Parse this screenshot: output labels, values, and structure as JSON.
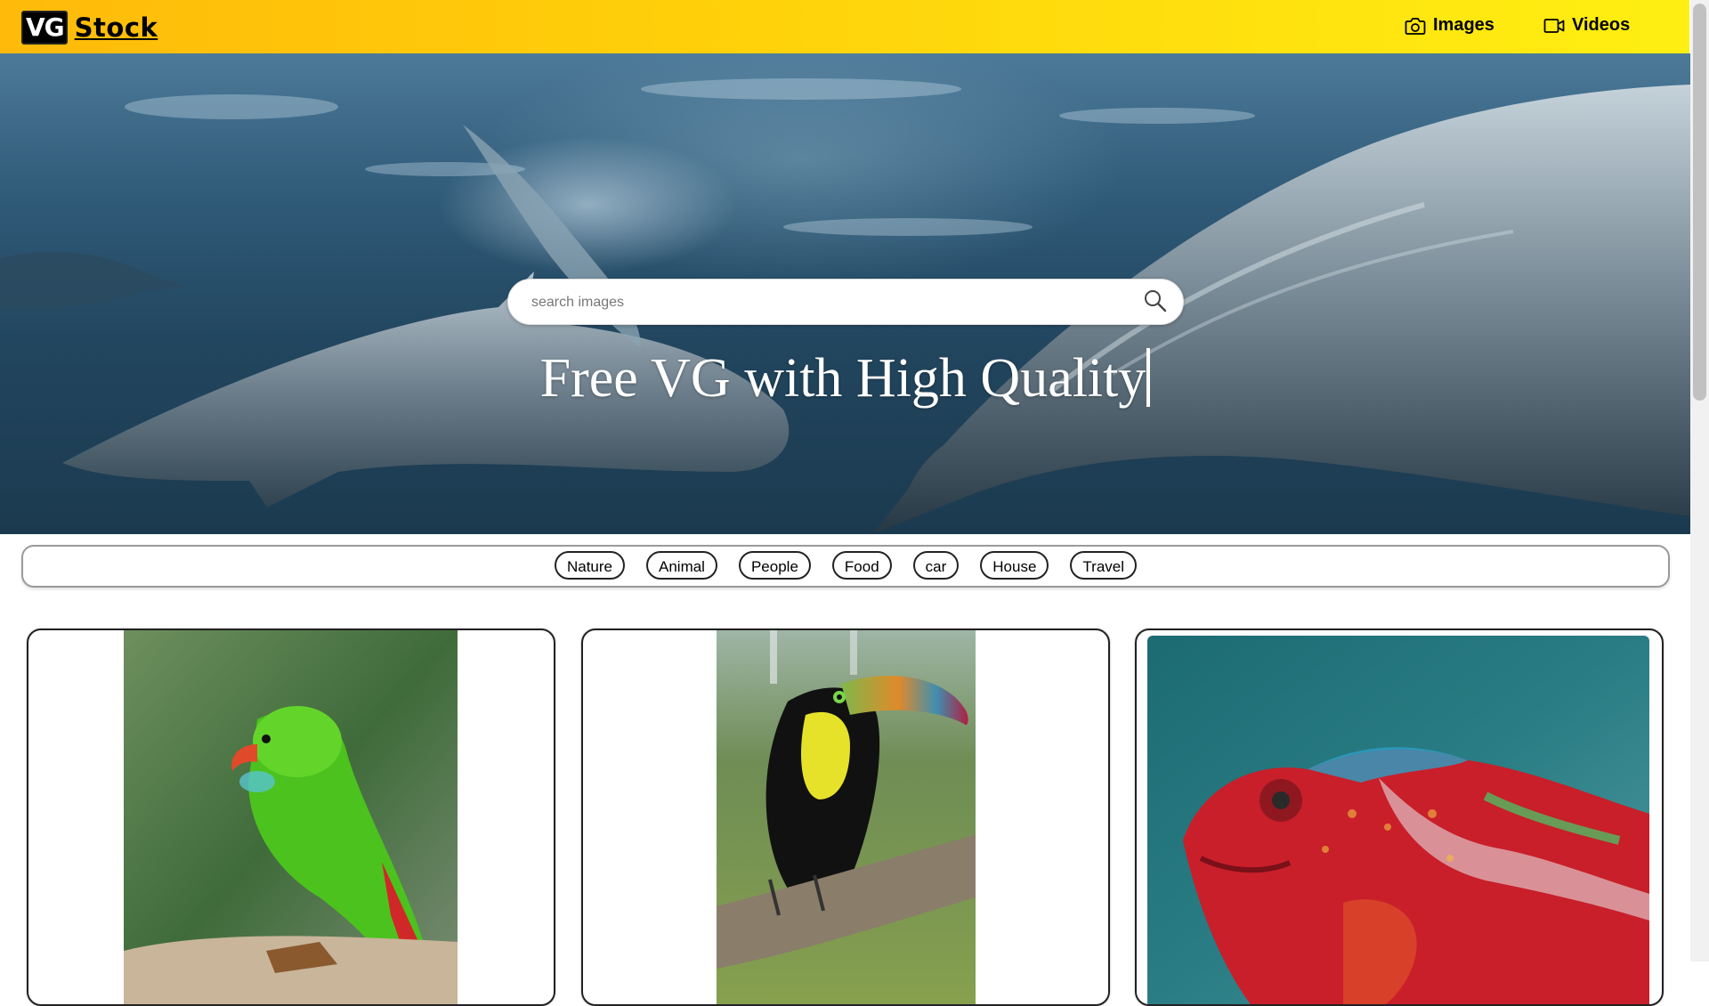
{
  "header": {
    "logo_mark": "VG",
    "logo_text": "Stock",
    "brand_color": "#ffc20a",
    "nav": [
      {
        "label": "Images",
        "icon": "camera-icon"
      },
      {
        "label": "Videos",
        "icon": "video-camera-icon"
      }
    ]
  },
  "hero": {
    "search_placeholder": "search images",
    "search_value": "",
    "search_icon": "search-icon",
    "title": "Free VG with High Quality",
    "background": "underwater dolphins photo"
  },
  "categories": [
    "Nature",
    "Animal",
    "People",
    "Food",
    "car",
    "House",
    "Travel"
  ],
  "gallery": [
    {
      "subject": "green parrot photo"
    },
    {
      "subject": "toucan photo"
    },
    {
      "subject": "chameleon photo"
    }
  ]
}
